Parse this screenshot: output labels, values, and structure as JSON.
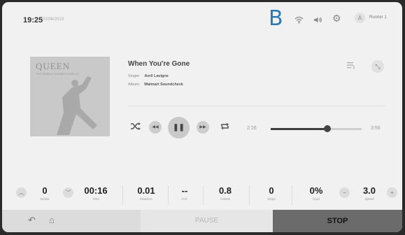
{
  "status_bar": {
    "time": "19:25",
    "date": "02/06/2019",
    "bluetooth_glyph": "B",
    "user_name": "Runner 1",
    "icons": [
      "wifi-icon",
      "volume-icon",
      "gear-icon",
      "user-icon"
    ]
  },
  "track": {
    "title": "When You're Gone",
    "singer_label": "Singer:",
    "singer": "Avril Lavigne",
    "album_label": "Album:",
    "album": "Walmart Soundcheck",
    "elapsed": "2:26",
    "duration": "3:56",
    "progress_fraction": 0.62
  },
  "album_art": {
    "band": "QUEEN",
    "subtitle": "THE JEWELS WOMBLE DWELLS"
  },
  "stats": [
    {
      "value": "0",
      "label": "Incline"
    },
    {
      "value": "00:16",
      "label": "Time"
    },
    {
      "value": "0.01",
      "label": "Distance"
    },
    {
      "value": "--",
      "label": "H.R."
    },
    {
      "value": "0.8",
      "label": "Calorie"
    },
    {
      "value": "0",
      "label": "Steps"
    },
    {
      "value": "0%",
      "label": "Goal"
    },
    {
      "value": "3.0",
      "label": "Speed"
    }
  ],
  "controls": {
    "pause_label": "PAUSE",
    "stop_label": "STOP"
  },
  "colors": {
    "bluetooth": "#2a7ab8",
    "stop_bg": "#6b6b6b",
    "progress": "#3d3d3d"
  }
}
